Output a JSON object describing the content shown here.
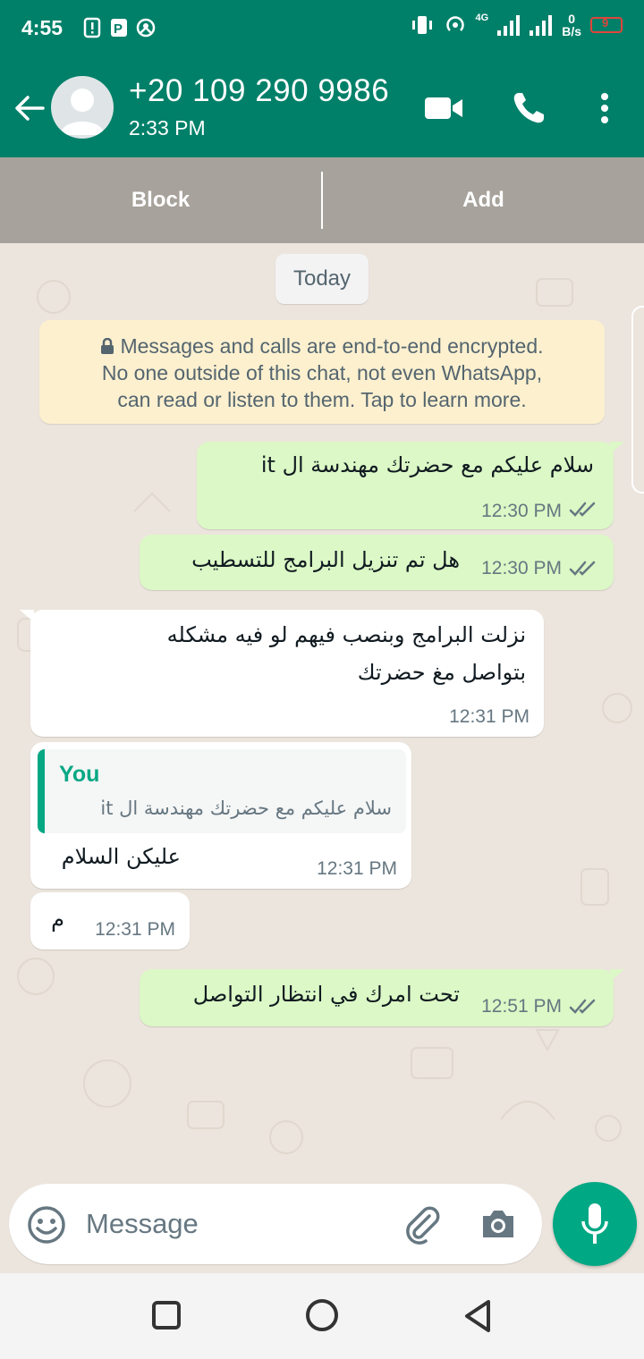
{
  "status_bar": {
    "time": "4:55",
    "network": "4G",
    "speed_value": "0",
    "speed_unit": "B/s",
    "battery": "9"
  },
  "header": {
    "contact": "+20 109 290 9986",
    "last_seen": "2:33 PM",
    "icons": [
      "back-arrow-icon",
      "avatar",
      "video-call-icon",
      "voice-call-icon",
      "more-options-icon"
    ]
  },
  "actions": {
    "block": "Block",
    "add": "Add"
  },
  "chat": {
    "date_chip": "Today",
    "encryption_line1": "Messages and calls are end-to-end encrypted.",
    "encryption_line2": "No one outside of this chat, not even WhatsApp,",
    "encryption_line3": "can read or listen to them. Tap to learn more.",
    "messages": [
      {
        "direction": "out",
        "text": "سلام عليكم مع حضرتك مهندسة ال it",
        "time": "12:30 PM",
        "status": "read"
      },
      {
        "direction": "out",
        "text": "هل تم تنزيل البرامج للتسطيب",
        "time": "12:30 PM",
        "status": "read"
      },
      {
        "direction": "in",
        "line1": "نزلت البرامج وبنصب فيهم لو فيه مشكله",
        "line2": "بتواصل مغ حضرتك",
        "time": "12:31 PM"
      },
      {
        "direction": "in",
        "quote_author": "You",
        "quote_text": "سلام عليكم مع حضرتك مهندسة ال it",
        "text": "عليكن السلام",
        "time": "12:31 PM"
      },
      {
        "direction": "in",
        "text": "م",
        "time": "12:31 PM"
      },
      {
        "direction": "out",
        "text": "تحت امرك في انتظار التواصل",
        "time": "12:51 PM",
        "status": "read"
      }
    ]
  },
  "composer": {
    "placeholder": "Message",
    "icons": [
      "emoji-icon",
      "attach-icon",
      "camera-icon",
      "mic-icon"
    ]
  },
  "colors": {
    "header": "#008069",
    "outgoing_bubble": "#dbf8c6",
    "incoming_bubble": "#ffffff",
    "accent": "#00a884",
    "encryption_note": "#fcf0cf"
  }
}
